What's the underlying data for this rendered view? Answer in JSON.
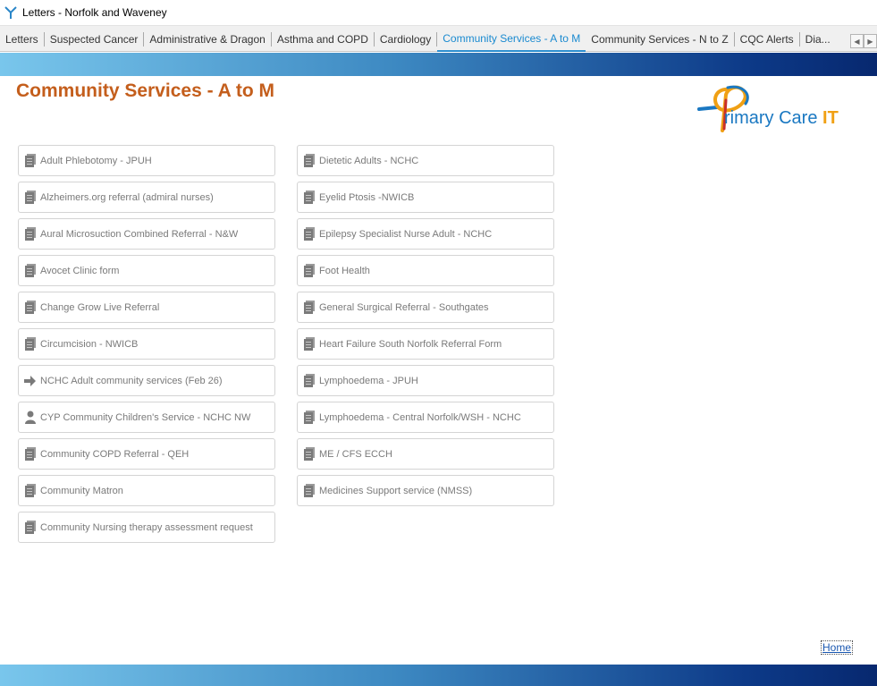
{
  "window": {
    "title": "Letters - Norfolk and Waveney"
  },
  "tabs": [
    {
      "label": "Letters"
    },
    {
      "label": "Suspected Cancer"
    },
    {
      "label": "Administrative & Dragon"
    },
    {
      "label": "Asthma and COPD"
    },
    {
      "label": "Cardiology"
    },
    {
      "label": "Community Services - A to M"
    },
    {
      "label": "Community Services - N to Z"
    },
    {
      "label": "CQC Alerts"
    },
    {
      "label": "Dia..."
    }
  ],
  "active_tab_index": 5,
  "page": {
    "title": "Community Services - A to M"
  },
  "logo": {
    "text_main": "rimary Care ",
    "text_accent": "IT"
  },
  "left_items": [
    {
      "label": "Adult Phlebotomy - JPUH",
      "icon": "document-icon"
    },
    {
      "label": "Alzheimers.org referral (admiral nurses)",
      "icon": "document-icon"
    },
    {
      "label": "Aural Microsuction Combined Referral - N&W",
      "icon": "document-icon"
    },
    {
      "label": "Avocet Clinic form",
      "icon": "document-icon"
    },
    {
      "label": "Change Grow Live Referral",
      "icon": "document-icon"
    },
    {
      "label": "Circumcision - NWICB",
      "icon": "document-icon"
    },
    {
      "label": "NCHC Adult community services  (Feb 26)",
      "icon": "arrow-right-icon"
    },
    {
      "label": "CYP Community Children's Service - NCHC NW",
      "icon": "person-icon"
    },
    {
      "label": "Community COPD Referral - QEH",
      "icon": "document-icon"
    },
    {
      "label": "Community Matron",
      "icon": "document-icon"
    },
    {
      "label": "Community Nursing therapy assessment request",
      "icon": "document-icon"
    }
  ],
  "right_items": [
    {
      "label": "Dietetic Adults - NCHC",
      "icon": "document-icon"
    },
    {
      "label": "Eyelid Ptosis -NWICB",
      "icon": "document-icon"
    },
    {
      "label": "Epilepsy Specialist Nurse Adult - NCHC",
      "icon": "document-icon"
    },
    {
      "label": "Foot Health",
      "icon": "document-icon"
    },
    {
      "label": "General Surgical Referral - Southgates",
      "icon": "document-icon"
    },
    {
      "label": "Heart Failure South Norfolk Referral Form",
      "icon": "document-icon"
    },
    {
      "label": "Lymphoedema - JPUH",
      "icon": "document-icon"
    },
    {
      "label": "Lymphoedema - Central Norfolk/WSH - NCHC",
      "icon": "document-icon"
    },
    {
      "label": "ME / CFS ECCH",
      "icon": "document-icon"
    },
    {
      "label": "Medicines Support service (NMSS)",
      "icon": "document-icon"
    }
  ],
  "footer": {
    "home_label": "Home"
  },
  "colors": {
    "title": "#c45e1c",
    "active_tab": "#1a8ad0",
    "band_start": "#79c6ec",
    "band_end": "#07286f"
  }
}
